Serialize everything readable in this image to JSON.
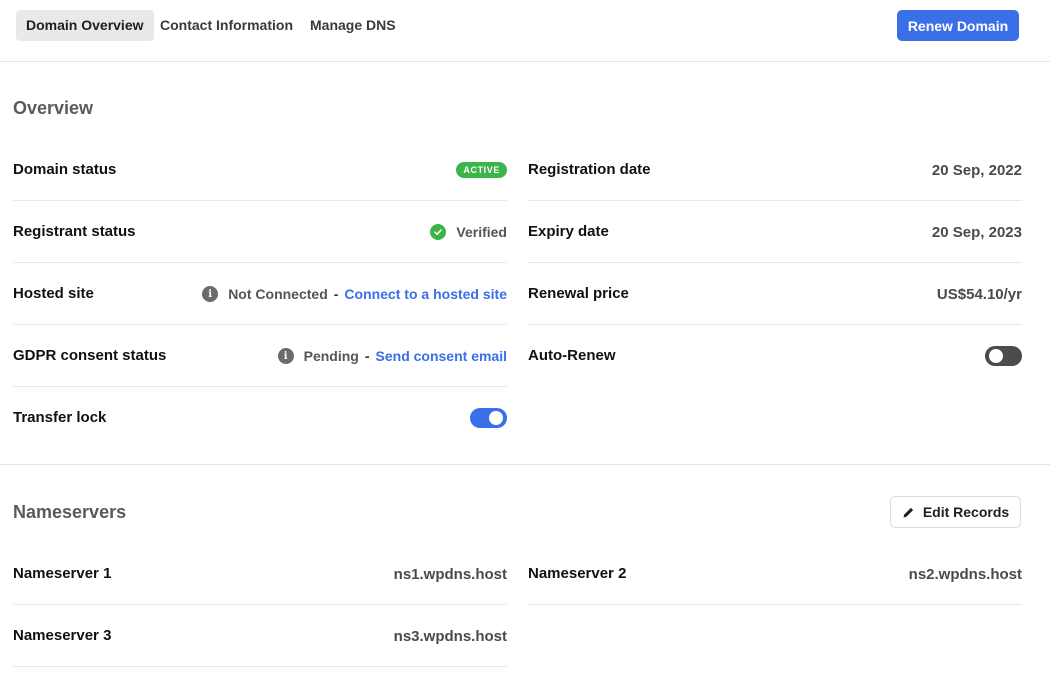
{
  "nav": {
    "tabs": [
      {
        "label": "Domain Overview",
        "active": true
      },
      {
        "label": "Contact Information",
        "active": false
      },
      {
        "label": "Manage DNS",
        "active": false
      }
    ],
    "renew_label": "Renew Domain"
  },
  "overview": {
    "title": "Overview",
    "domain_status": {
      "label": "Domain status",
      "badge": "ACTIVE"
    },
    "registrant_status": {
      "label": "Registrant status",
      "value": "Verified"
    },
    "hosted_site": {
      "label": "Hosted site",
      "value": "Not Connected",
      "separator": "-",
      "link": "Connect to a hosted site"
    },
    "gdpr": {
      "label": "GDPR consent status",
      "value": "Pending",
      "separator": "-",
      "link": "Send consent email"
    },
    "transfer_lock": {
      "label": "Transfer lock",
      "enabled": true
    },
    "registration_date": {
      "label": "Registration date",
      "value": "20 Sep, 2022"
    },
    "expiry_date": {
      "label": "Expiry date",
      "value": "20 Sep, 2023"
    },
    "renewal_price": {
      "label": "Renewal price",
      "value": "US$54.10/yr"
    },
    "auto_renew": {
      "label": "Auto-Renew",
      "enabled": false
    }
  },
  "nameservers": {
    "title": "Nameservers",
    "edit_label": "Edit Records",
    "items": [
      {
        "label": "Nameserver 1",
        "value": "ns1.wpdns.host"
      },
      {
        "label": "Nameserver 2",
        "value": "ns2.wpdns.host"
      },
      {
        "label": "Nameserver 3",
        "value": "ns3.wpdns.host"
      }
    ]
  },
  "colors": {
    "accent": "#3a6fe8",
    "success": "#3bb54a",
    "toggle_off": "#4b4b4b"
  }
}
